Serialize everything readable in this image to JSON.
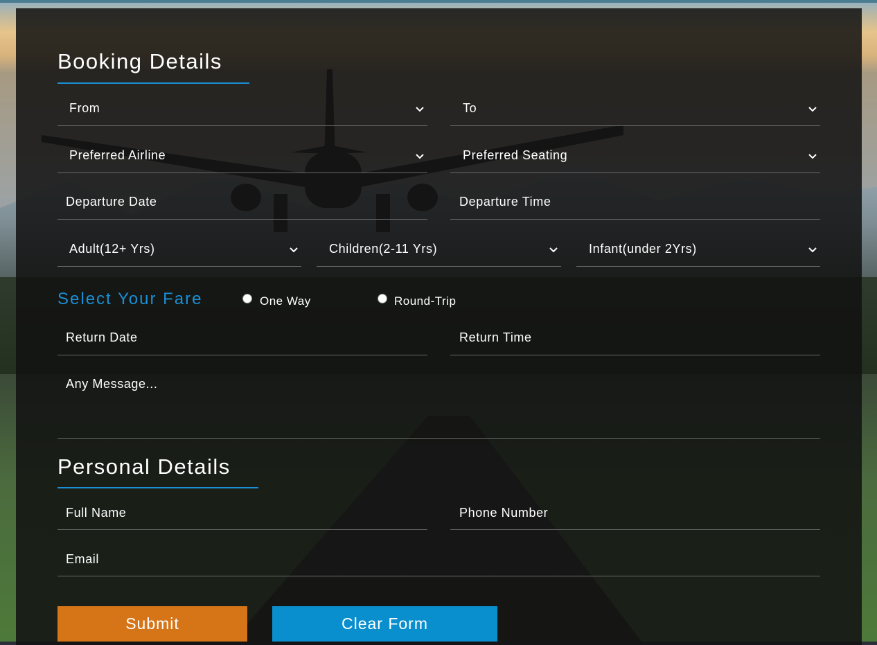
{
  "booking": {
    "title": "Booking Details",
    "from": "From",
    "to": "To",
    "preferred_airline": "Preferred Airline",
    "preferred_seating": "Preferred Seating",
    "departure_date": "Departure Date",
    "departure_time": "Departure Time",
    "adult": "Adult(12+ Yrs)",
    "children": "Children(2-11 Yrs)",
    "infant": "Infant(under 2Yrs)",
    "fare_title": "Select Your Fare",
    "one_way": "One Way",
    "round_trip": "Round-Trip",
    "return_date": "Return Date",
    "return_time": "Return Time",
    "message": "Any Message..."
  },
  "personal": {
    "title": "Personal Details",
    "full_name": "Full Name",
    "phone": "Phone Number",
    "email": "Email"
  },
  "actions": {
    "submit": "Submit",
    "clear": "Clear Form"
  },
  "colors": {
    "accent": "#1b8fd4",
    "submit": "#d57518",
    "clear": "#0a8fce"
  }
}
